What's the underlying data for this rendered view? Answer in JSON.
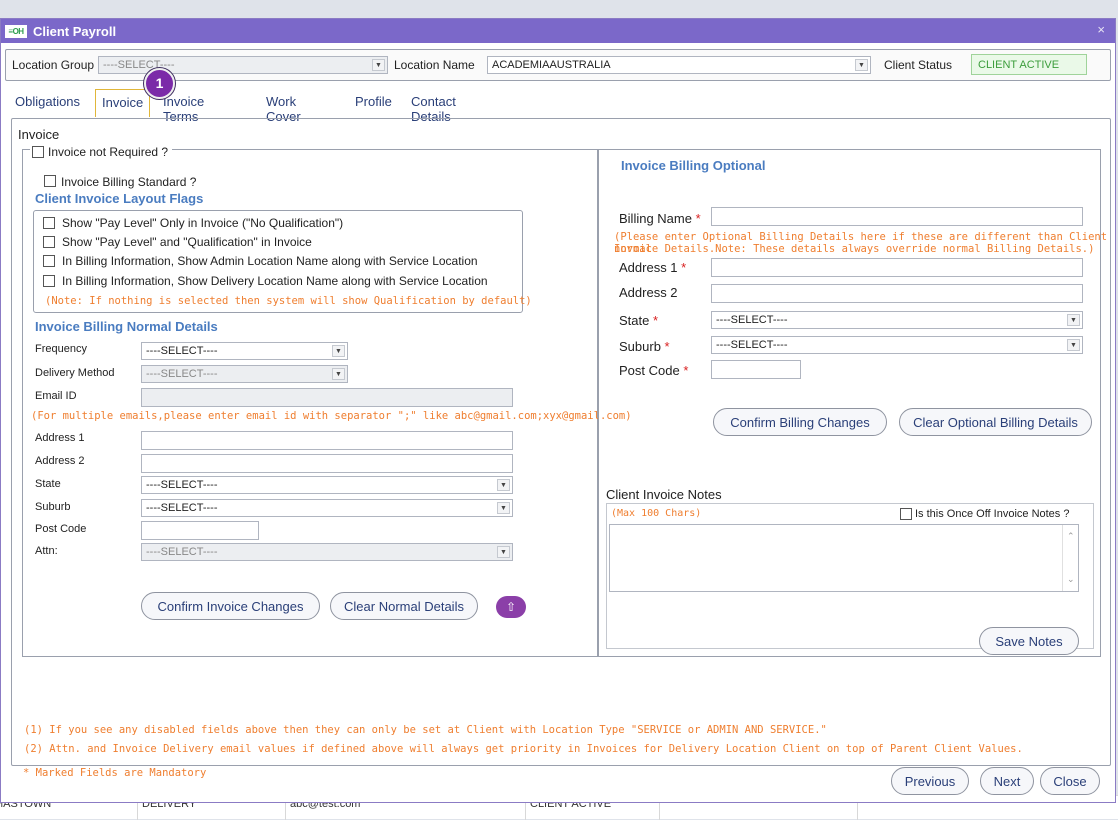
{
  "background_row": {
    "c1": "MASTOWN",
    "c2": "DELIVERY",
    "c3": "abc@test.com",
    "c4": "CLIENT ACTIVE"
  },
  "window": {
    "logo": "≡OH",
    "title": "Client Payroll",
    "close": "×"
  },
  "filters": {
    "location_group_label": "Location Group",
    "location_group_value": "----SELECT----",
    "location_name_label": "Location Name",
    "location_name_value": "ACADEMIAAUSTRALIA",
    "client_status_label": "Client Status",
    "client_status_value": "CLIENT ACTIVE"
  },
  "tabs": [
    "Obligations",
    "Invoice",
    "Invoice Terms",
    "Work Cover",
    "Profile",
    "Contact Details"
  ],
  "active_tab": "Invoice",
  "step_badge": "1",
  "panel_title": "Invoice",
  "left": {
    "invoice_not_required": "Invoice not Required ?",
    "billing_standard": "Invoice Billing Standard ?",
    "layout_flags_title": "Client Invoice Layout Flags",
    "flags": [
      "Show \"Pay Level\" Only in Invoice (\"No Qualification\")",
      "Show \"Pay Level\" and \"Qualification\" in Invoice",
      "In Billing Information, Show Admin Location Name along with Service Location",
      "In Billing Information, Show Delivery Location Name along with Service Location"
    ],
    "flags_note": "(Note: If nothing is selected then system will show Qualification by default)",
    "normal_title": "Invoice Billing Normal Details",
    "frequency_label": "Frequency",
    "frequency_value": "----SELECT----",
    "delivery_label": "Delivery Method",
    "delivery_value": "----SELECT----",
    "email_label": "Email ID",
    "email_note": "(For multiple emails,please enter email id with separator \";\" like abc@gmail.com;xyx@gmail.com)",
    "address1_label": "Address 1",
    "address2_label": "Address 2",
    "state_label": "State",
    "state_value": "----SELECT----",
    "suburb_label": "Suburb",
    "suburb_value": "----SELECT----",
    "postcode_label": "Post Code",
    "attn_label": "Attn:",
    "attn_value": "----SELECT----",
    "confirm_btn": "Confirm Invoice Changes",
    "clear_btn": "Clear Normal Details",
    "up_icon": "⇧"
  },
  "right": {
    "optional_title": "Invoice Billing Optional",
    "billing_name_label": "Billing Name",
    "required_mark": "*",
    "optional_note_1": "(Please enter Optional Billing Details here if these are different than Client normal",
    "optional_note_2": "Invoice Details.Note: These details always override normal Billing Details.)",
    "address1_label": "Address 1",
    "address2_label": "Address 2",
    "state_label": "State",
    "state_value": "----SELECT----",
    "suburb_label": "Suburb",
    "suburb_value": "----SELECT----",
    "postcode_label": "Post Code",
    "confirm_btn": "Confirm Billing Changes",
    "clear_btn": "Clear Optional Billing Details",
    "notes_title": "Client Invoice Notes",
    "notes_max": "(Max 100 Chars)",
    "once_off_label": "Is this Once Off Invoice Notes ?",
    "save_btn": "Save Notes"
  },
  "footnotes": [
    "(1) If you see any disabled fields above then they can only be set at Client with Location Type \"SERVICE or ADMIN AND SERVICE.\"",
    "(2) Attn. and Invoice Delivery email values if defined above will always get priority in Invoices for Delivery Location Client on top of Parent Client Values."
  ],
  "mandatory_note": "* Marked Fields are Mandatory",
  "nav": {
    "previous": "Previous",
    "next": "Next",
    "close": "Close"
  }
}
